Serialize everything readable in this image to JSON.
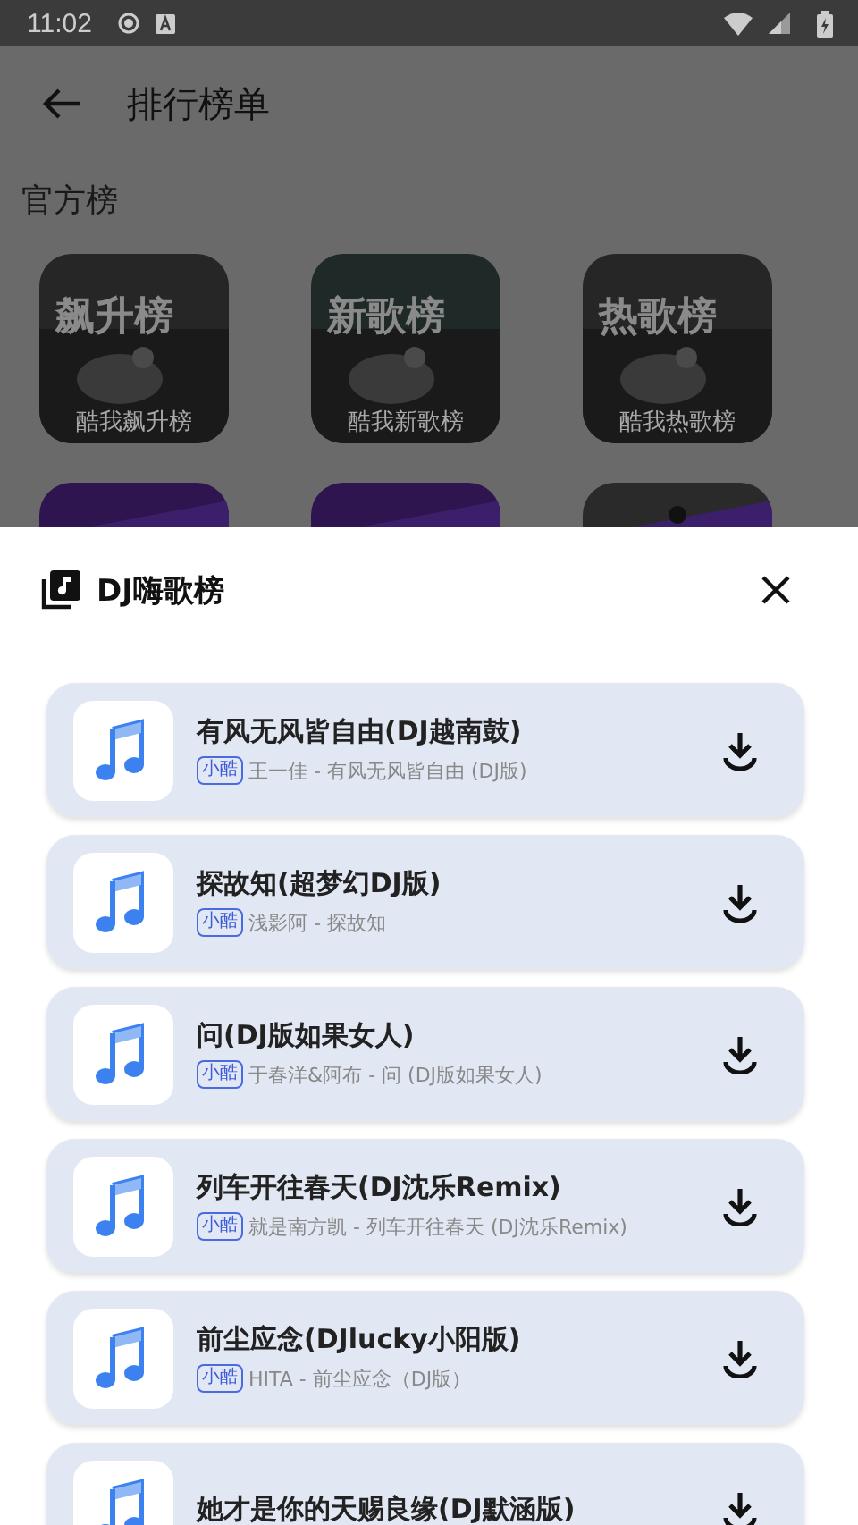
{
  "status_bar": {
    "time": "11:02"
  },
  "top_bar": {
    "title": "排行榜单"
  },
  "section": {
    "title": "官方榜"
  },
  "boards": [
    {
      "kind": "board",
      "cover_title": "飙升榜",
      "label": "酷我飙升榜"
    },
    {
      "kind": "board",
      "cover_title": "新歌榜",
      "label": "酷我新歌榜"
    },
    {
      "kind": "board",
      "cover_title": "热歌榜",
      "label": "酷我热歌榜"
    },
    {
      "kind": "picture"
    },
    {
      "kind": "picture"
    },
    {
      "kind": "picture"
    }
  ],
  "sheet": {
    "title": "DJ嗨歌榜",
    "songs": [
      {
        "title": "有风无风皆自由(DJ越南鼓)",
        "source": "小酷",
        "subtitle": "王一佳 - 有风无风皆自由 (DJ版)"
      },
      {
        "title": "探故知(超梦幻DJ版)",
        "source": "小酷",
        "subtitle": "浅影阿 - 探故知"
      },
      {
        "title": "问(DJ版如果女人)",
        "source": "小酷",
        "subtitle": "于春洋&阿布 - 问 (DJ版如果女人)"
      },
      {
        "title": "列车开往春天(DJ沈乐Remix)",
        "source": "小酷",
        "subtitle": "就是南方凯 - 列车开往春天 (DJ沈乐Remix)"
      },
      {
        "title": "前尘应念(DJlucky小阳版)",
        "source": "小酷",
        "subtitle": "HITA - 前尘应念（DJ版）"
      },
      {
        "title": "她才是你的天赐良缘(DJ默涵版)"
      }
    ]
  }
}
